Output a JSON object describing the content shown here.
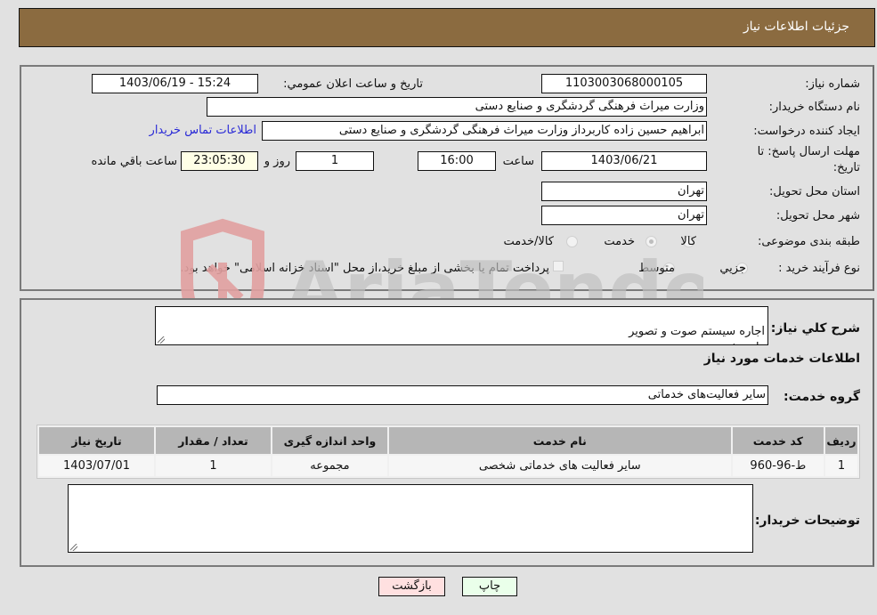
{
  "header": {
    "title": "جزئیات اطلاعات نیاز"
  },
  "form": {
    "need_number": {
      "label": "شماره نیاز:",
      "value": "1103003068000105"
    },
    "announce_datetime": {
      "label": "تاريخ و ساعت اعلان عمومي:",
      "value": "1403/06/19 - 15:24"
    },
    "buyer_org": {
      "label": "نام دستگاه خریدار:",
      "value": "وزارت میراث فرهنگی  گردشگری و صنایع دستی"
    },
    "requester": {
      "label": "ایجاد کننده درخواست:",
      "value": "ابراهیم حسین زاده کاربرداز وزارت میراث فرهنگی  گردشگری و صنایع دستی"
    },
    "buyer_contact_link": "اطلاعات تماس خریدار",
    "deadline": {
      "label_line1": "مهلت ارسال پاسخ: تا",
      "label_line2": "تاریخ:",
      "date": "1403/06/21",
      "time_label": "ساعت",
      "time": "16:00",
      "days": "1",
      "days_label": "روز و",
      "remaining": "23:05:30",
      "remaining_label": "ساعت باقي مانده"
    },
    "province": {
      "label": "استان محل تحویل:",
      "value": "تهران"
    },
    "city": {
      "label": "شهر محل تحویل:",
      "value": "تهران"
    },
    "category": {
      "label": "طبقه بندی موضوعی:",
      "options": [
        "کالا",
        "خدمت",
        "کالا/خدمت"
      ],
      "selected": "خدمت"
    },
    "purchase_type": {
      "label": "نوع فرآیند خرید :",
      "options": [
        "جزيي",
        "متوسط"
      ],
      "selected": "جزيي",
      "treasury_note": "پرداخت تمام یا بخشی از مبلغ خرید،از محل \"اسناد خزانه اسلامی\" خواهد بود."
    }
  },
  "details": {
    "description_label": "شرح كلي نياز:",
    "description": "اجاره سیستم صوت و تصویر\nطبق شرح پیوست",
    "services_heading": "اطلاعات خدمات مورد نياز",
    "service_group_label": "گروه خدمت:",
    "service_group": "سایر فعالیت‌های خدماتی",
    "table": {
      "headers": [
        "ردیف",
        "کد خدمت",
        "نام خدمت",
        "واحد اندازه گیری",
        "تعداد / مقدار",
        "تاریخ نیاز"
      ],
      "rows": [
        [
          "1",
          "ط-96-960",
          "سایر فعالیت های خدماتی شخصی",
          "مجموعه",
          "1",
          "1403/07/01"
        ]
      ]
    },
    "buyer_notes_label": "توضیحات خریدار:",
    "buyer_notes": ""
  },
  "buttons": {
    "print": "چاپ",
    "back": "بازگشت"
  },
  "watermark": {
    "text": "AriaTender.neT"
  },
  "colors": {
    "header_bg": "#8b6b40",
    "print_bg": "#eaffea",
    "back_bg": "#ffe0e0",
    "link": "#2929d6"
  }
}
